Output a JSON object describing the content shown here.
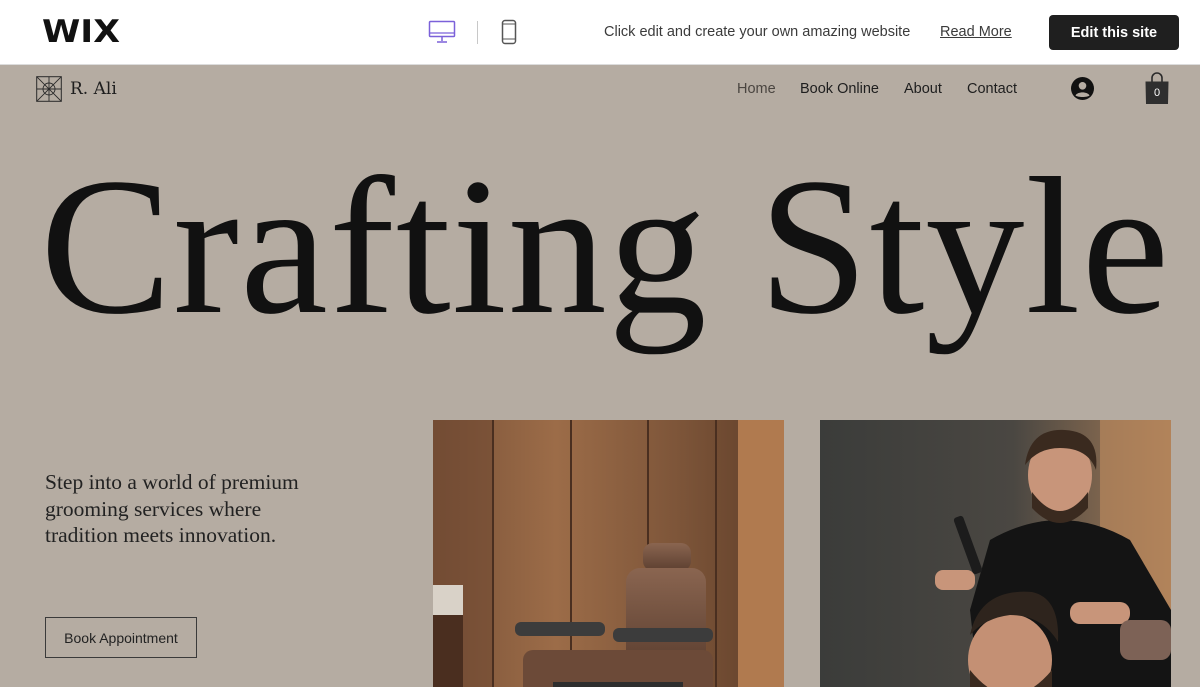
{
  "wix_bar": {
    "logo": "WIX",
    "promo_text": "Click edit and create your own amazing website",
    "read_more": "Read More",
    "edit_button": "Edit this site",
    "active_device_color": "#7b61d9"
  },
  "site": {
    "logo_text": "R. Ali",
    "nav": {
      "home": "Home",
      "book_online": "Book Online",
      "about": "About",
      "contact": "Contact"
    },
    "cart_count": "0",
    "hero_title": "Crafting Style",
    "hero_text": "Step into a world of premium grooming services where tradition meets innovation.",
    "book_button": "Book Appointment",
    "background_color": "#b5aca2",
    "icons": [
      "desktop-icon",
      "mobile-icon",
      "logo-mark-icon",
      "account-icon",
      "shopping-bag-icon"
    ],
    "images": [
      "barber-chair-photo",
      "barber-cutting-hair-photo"
    ]
  }
}
